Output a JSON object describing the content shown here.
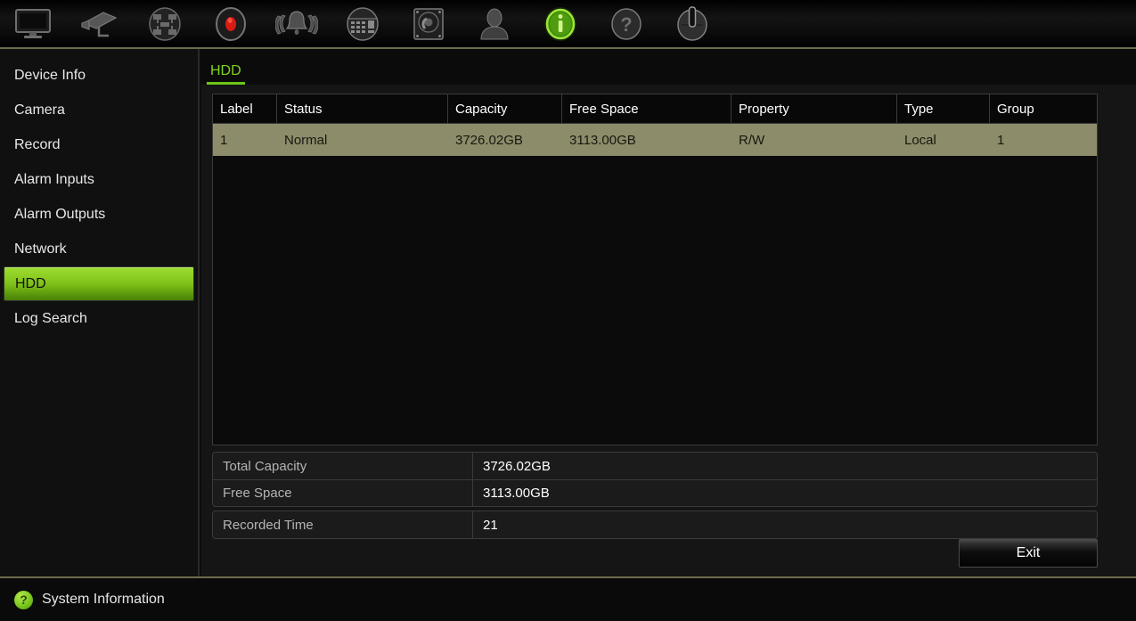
{
  "toolbar": {
    "items": [
      {
        "name": "monitor-icon",
        "label": "Display"
      },
      {
        "name": "camera-icon",
        "label": "Camera"
      },
      {
        "name": "network-icon",
        "label": "Network"
      },
      {
        "name": "record-icon",
        "label": "Record"
      },
      {
        "name": "alarm-bell-icon",
        "label": "Alarm"
      },
      {
        "name": "device-panel-icon",
        "label": "Device"
      },
      {
        "name": "hdd-icon",
        "label": "HDD"
      },
      {
        "name": "user-icon",
        "label": "User"
      },
      {
        "name": "info-icon",
        "label": "System Information"
      },
      {
        "name": "help-icon",
        "label": "Help"
      },
      {
        "name": "power-icon",
        "label": "Shutdown"
      }
    ],
    "active_index": 8
  },
  "sidebar": {
    "items": [
      {
        "label": "Device Info",
        "selected": false
      },
      {
        "label": "Camera",
        "selected": false
      },
      {
        "label": "Record",
        "selected": false
      },
      {
        "label": "Alarm Inputs",
        "selected": false
      },
      {
        "label": "Alarm Outputs",
        "selected": false
      },
      {
        "label": "Network",
        "selected": false
      },
      {
        "label": "HDD",
        "selected": true
      },
      {
        "label": "Log Search",
        "selected": false
      }
    ]
  },
  "main": {
    "tabs": [
      {
        "label": "HDD",
        "active": true
      }
    ],
    "table": {
      "columns": [
        "Label",
        "Status",
        "Capacity",
        "Free Space",
        "Property",
        "Type",
        "Group"
      ],
      "rows": [
        {
          "selected": true,
          "cells": [
            "1",
            "Normal",
            "3726.02GB",
            "3113.00GB",
            "R/W",
            "Local",
            "1"
          ]
        }
      ]
    },
    "summary": [
      {
        "label": "Total Capacity",
        "value": "3726.02GB"
      },
      {
        "label": "Free Space",
        "value": "3113.00GB"
      },
      {
        "label": "Recorded Time",
        "value": "21"
      }
    ],
    "exit_label": "Exit"
  },
  "statusbar": {
    "icon": "help-circle-icon",
    "icon_glyph": "?",
    "text": "System Information"
  },
  "colors": {
    "accent_green": "#7ed321",
    "selected_row": "#8c8c6b",
    "panel_bg": "#151515",
    "divider": "#6d6b4e"
  }
}
